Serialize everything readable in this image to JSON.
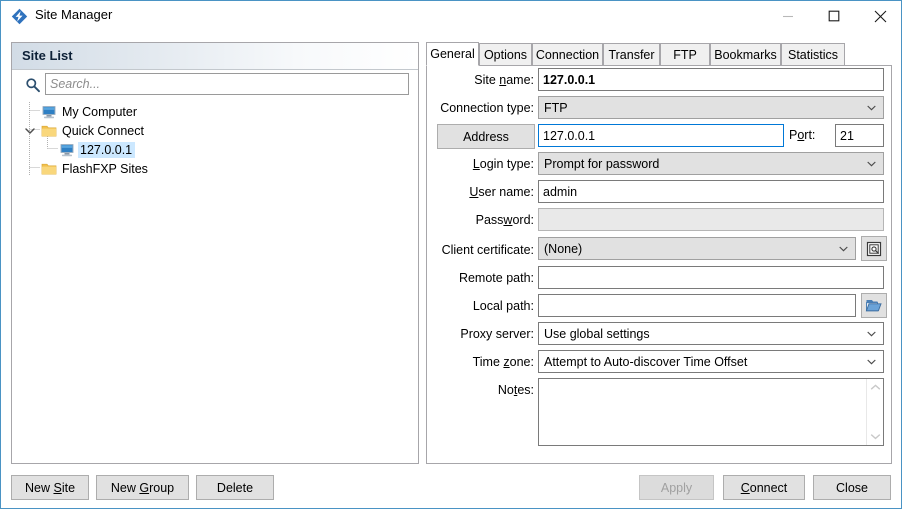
{
  "window": {
    "title": "Site Manager",
    "icon": "filezilla-logo-icon",
    "border_color": "#4a93c4",
    "controls": {
      "minimize": "minimize-icon",
      "maximize": "maximize-icon",
      "close": "close-icon"
    }
  },
  "sidebar": {
    "header": "Site List",
    "search": {
      "placeholder": "Search...",
      "value": "",
      "icon": "search-icon"
    },
    "tree": [
      {
        "label": "My Computer",
        "icon": "computer-icon",
        "depth": 0,
        "selected": false,
        "expandable": false
      },
      {
        "label": "Quick Connect",
        "icon": "folder-icon",
        "depth": 0,
        "selected": false,
        "expandable": true,
        "expanded": true
      },
      {
        "label": "127.0.0.1",
        "icon": "computer-icon",
        "depth": 1,
        "selected": true,
        "expandable": false
      },
      {
        "label": "FlashFXP Sites",
        "icon": "folder-icon",
        "depth": 0,
        "selected": false,
        "expandable": false
      }
    ],
    "buttons": {
      "new_site": "New Site",
      "new_site_accel": "S",
      "new_group": "New Group",
      "new_group_accel": "G",
      "delete": "Delete"
    }
  },
  "tabs": [
    {
      "label": "General",
      "active": true
    },
    {
      "label": "Options",
      "active": false
    },
    {
      "label": "Connection",
      "active": false
    },
    {
      "label": "Transfer",
      "active": false
    },
    {
      "label": "FTP",
      "active": false
    },
    {
      "label": "Bookmarks",
      "active": false
    },
    {
      "label": "Statistics",
      "active": false
    }
  ],
  "general": {
    "site_name": {
      "label": "Site name:",
      "value": "127.0.0.1"
    },
    "connection_type": {
      "label": "Connection type:",
      "value": "FTP"
    },
    "address": {
      "button_label": "Address",
      "value": "127.0.0.1"
    },
    "port": {
      "label": "Port:",
      "value": "21"
    },
    "login_type": {
      "label": "Login type:",
      "value": "Prompt for password"
    },
    "user_name": {
      "label": "User name:",
      "value": "admin"
    },
    "password": {
      "label": "Password:",
      "value": ""
    },
    "client_certificate": {
      "label": "Client certificate:",
      "value": "(None)",
      "button_icon": "certificate-icon"
    },
    "remote_path": {
      "label": "Remote path:",
      "value": ""
    },
    "local_path": {
      "label": "Local path:",
      "value": "",
      "button_icon": "folder-browse-icon"
    },
    "proxy_server": {
      "label": "Proxy server:",
      "value": "Use global settings"
    },
    "time_zone": {
      "label": "Time zone:",
      "value": "Attempt to Auto-discover Time Offset"
    },
    "notes": {
      "label": "Notes:",
      "value": ""
    }
  },
  "footer": {
    "apply": "Apply",
    "apply_enabled": false,
    "connect": "Connect",
    "close": "Close"
  },
  "colors": {
    "accent": "#0078d7",
    "selection": "#cce8ff",
    "folder": "#f5c453",
    "button_face": "#e1e1e1"
  }
}
